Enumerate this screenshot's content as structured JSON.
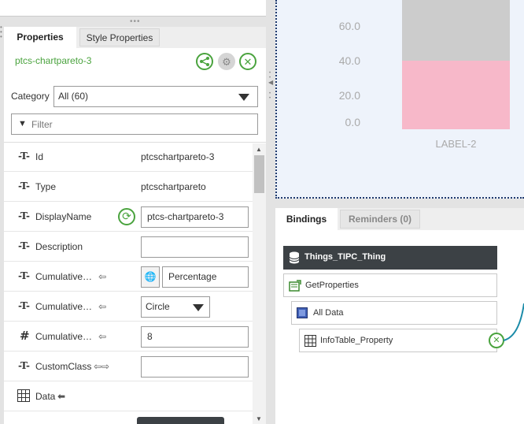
{
  "tabs": {
    "properties": "Properties",
    "style": "Style Properties"
  },
  "widget": {
    "name": "ptcs-chartpareto-3"
  },
  "category": {
    "label": "Category",
    "selected": "All (60)"
  },
  "filter": {
    "placeholder": "Filter"
  },
  "properties": [
    {
      "type": "T",
      "name": "Id",
      "value": "ptcschartpareto-3"
    },
    {
      "type": "T",
      "name": "Type",
      "value": "ptcschartpareto"
    },
    {
      "type": "T",
      "name": "DisplayName",
      "value": "ptcs-chartpareto-3"
    },
    {
      "type": "T",
      "name": "Description",
      "value": ""
    },
    {
      "type": "T",
      "name": "Cumulative…",
      "value": "Percentage"
    },
    {
      "type": "T",
      "name": "Cumulative…",
      "value": "Circle"
    },
    {
      "type": "#",
      "name": "Cumulative…",
      "value": "8"
    },
    {
      "type": "T",
      "name": "CustomClass",
      "value": ""
    },
    {
      "type": "grid",
      "name": "Data",
      "value": ""
    }
  ],
  "chart": {
    "yticks": [
      "60.0",
      "40.0",
      "20.0",
      "0.0"
    ],
    "xlabel": "LABEL-2",
    "colors": {
      "bar_top": "#cccccc",
      "bar_bottom": "#f7b8c9"
    }
  },
  "bindings": {
    "tab_bindings": "Bindings",
    "tab_reminders": "Reminders (0)",
    "thing": "Things_TIPC_Thing",
    "service": "GetProperties",
    "all_data": "All Data",
    "property": "InfoTable_Property"
  },
  "colors": {
    "accent": "#4aa33e",
    "node_dark": "#3c4145",
    "canvas_border": "#1f3a6e"
  }
}
